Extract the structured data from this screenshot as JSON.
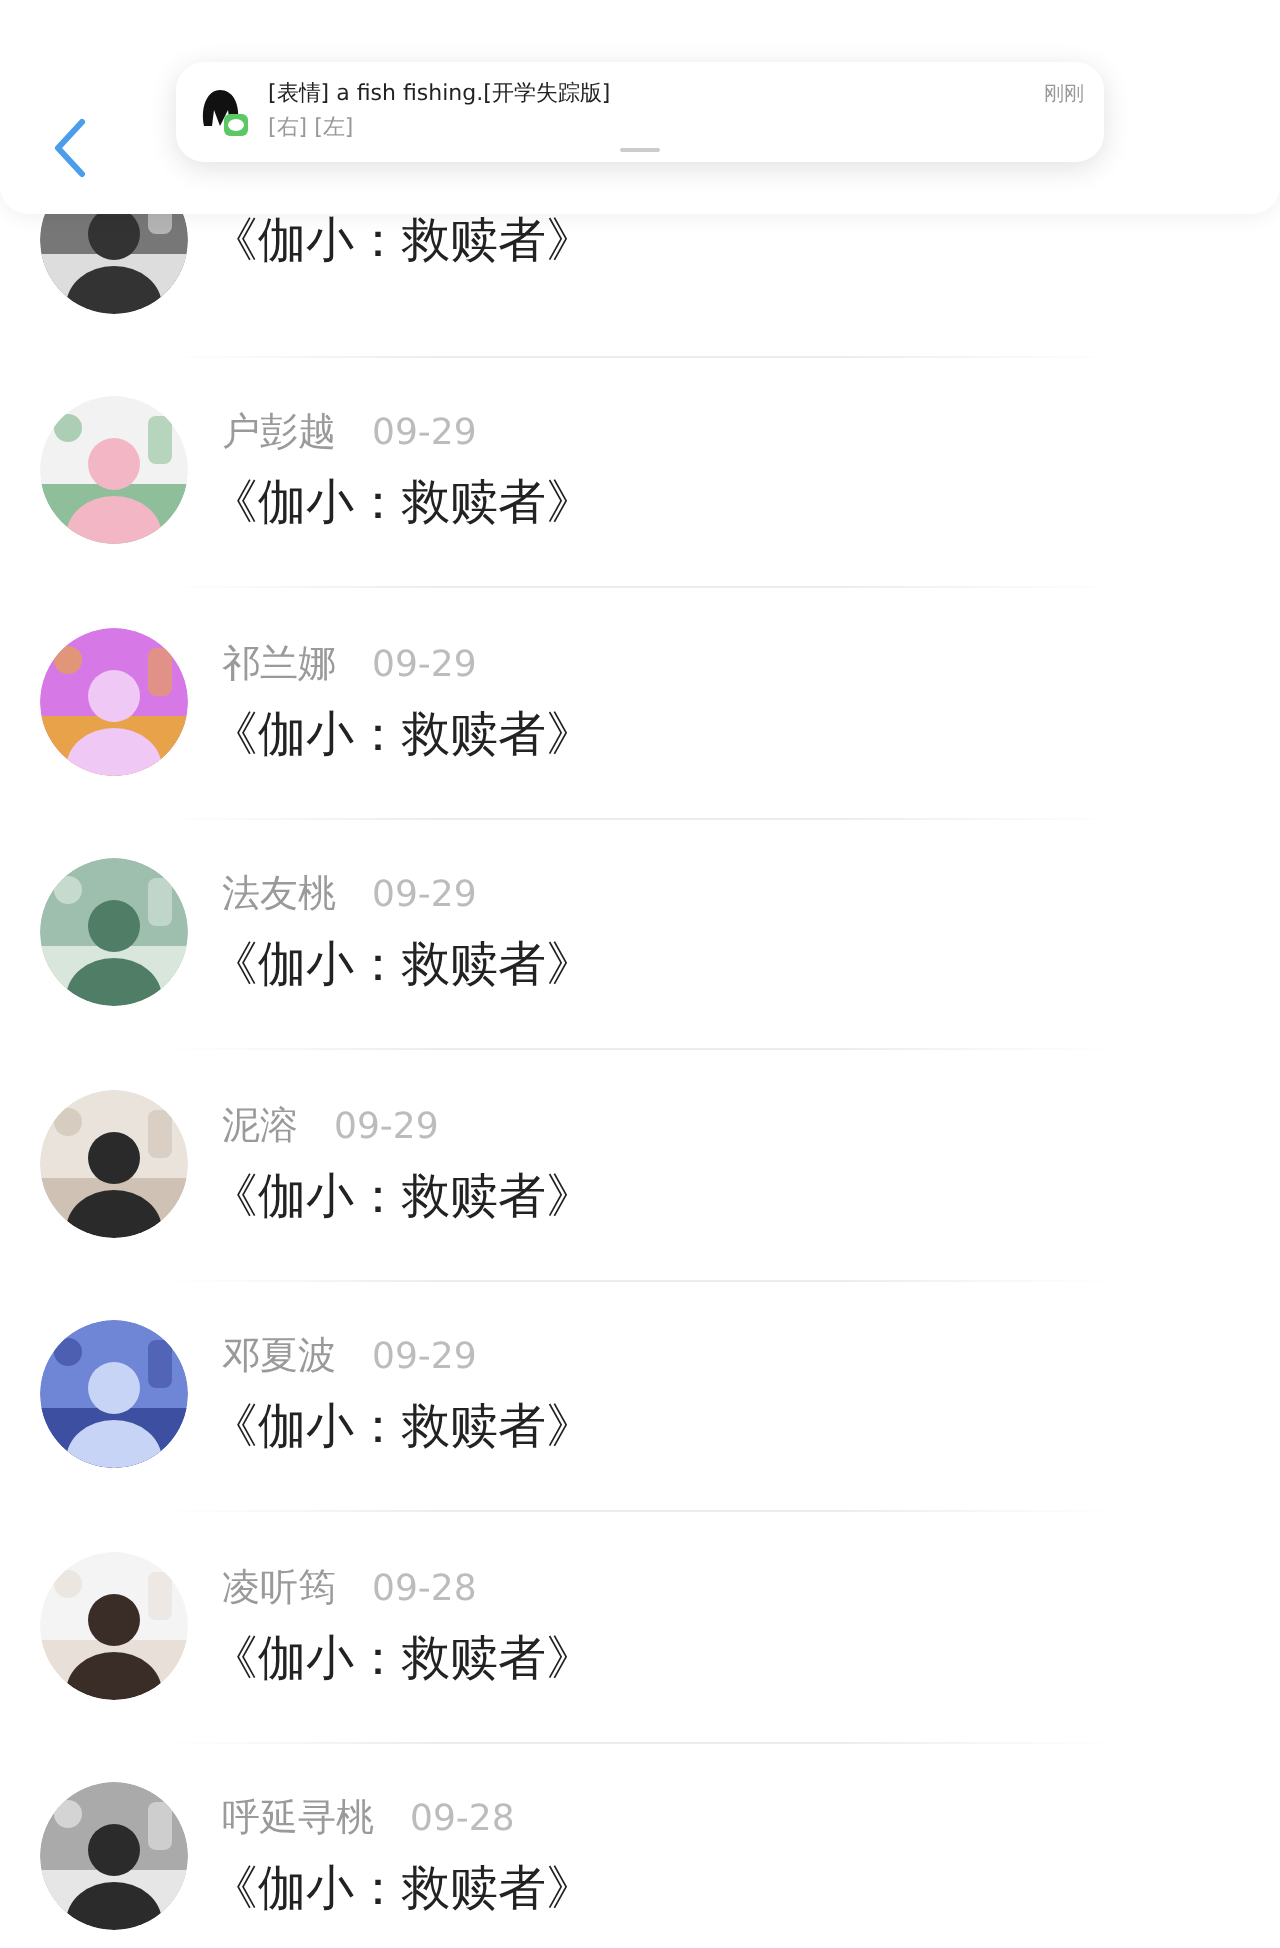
{
  "notification": {
    "title": "[表情] a fish fishing.[开学失踪版]",
    "body": "[右] [左]",
    "time": "刚刚"
  },
  "rows": [
    {
      "message": "《伽小：救赎者》"
    },
    {
      "name": "户彭越",
      "date": "09-29",
      "message": "《伽小：救赎者》"
    },
    {
      "name": "祁兰娜",
      "date": "09-29",
      "message": "《伽小：救赎者》"
    },
    {
      "name": "法友桃",
      "date": "09-29",
      "message": "《伽小：救赎者》"
    },
    {
      "name": "泥溶",
      "date": "09-29",
      "message": "《伽小：救赎者》"
    },
    {
      "name": "邓夏波",
      "date": "09-29",
      "message": "《伽小：救赎者》"
    },
    {
      "name": "凌听筠",
      "date": "09-28",
      "message": "《伽小：救赎者》"
    },
    {
      "name": "呼延寻桃",
      "date": "09-28",
      "message": "《伽小：救赎者》"
    }
  ]
}
